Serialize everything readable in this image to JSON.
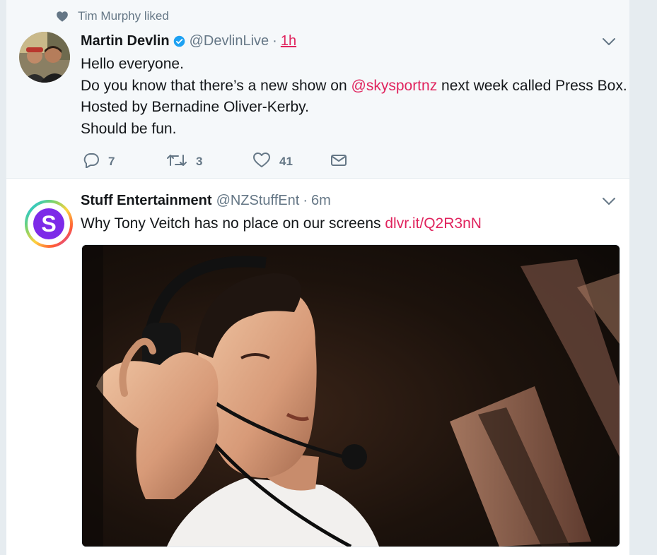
{
  "feed": {
    "tweets": [
      {
        "context": {
          "icon": "heart-icon",
          "text": "Tim Murphy liked"
        },
        "author": {
          "name": "Martin Devlin",
          "verified": true,
          "handle": "@DevlinLive",
          "separator": "·",
          "time": "1h"
        },
        "text": {
          "line1": "Hello everyone.",
          "line2_before": "Do you know that there’s a new show on ",
          "line2_mention": "@skysportnz",
          "line2_after": " next week called Press Box.",
          "line3": "Hosted by Bernadine Oliver-Kerby.",
          "line4": "Should be fun."
        },
        "actions": {
          "reply_count": "7",
          "retweet_count": "3",
          "like_count": "41"
        }
      },
      {
        "author": {
          "name": "Stuff Entertainment",
          "handle": "@NZStuffEnt",
          "separator": "·",
          "time": "6m",
          "avatar_letter": "S"
        },
        "text": {
          "body": "Why Tony Veitch has no place on our screens ",
          "link": "dlvr.it/Q2R3nN"
        },
        "media": {
          "description_icon": "photo-man-with-headset"
        }
      }
    ]
  },
  "colors": {
    "link": "#e0245e",
    "verified": "#1da1f2",
    "muted": "#657786",
    "highlight_bg": "#f5f8fa"
  }
}
